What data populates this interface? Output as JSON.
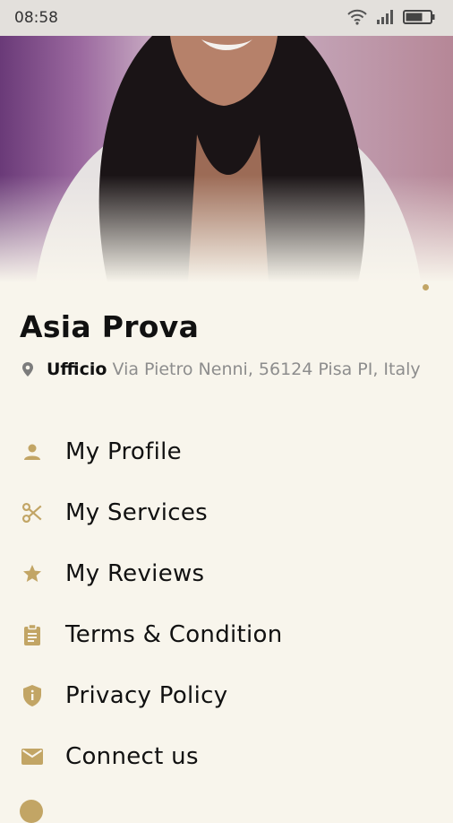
{
  "status_bar": {
    "time": "08:58",
    "icons": [
      "wifi-icon",
      "signal-icon",
      "battery-icon"
    ]
  },
  "profile": {
    "name": "Asia Prova",
    "address_label": "Ufficio",
    "address": "Via Pietro Nenni, 56124 Pisa PI, Italy"
  },
  "menu": {
    "items": [
      {
        "label": "My Profile",
        "icon": "person-icon"
      },
      {
        "label": "My Services",
        "icon": "scissors-icon"
      },
      {
        "label": "My Reviews",
        "icon": "star-icon"
      },
      {
        "label": "Terms & Condition",
        "icon": "clipboard-icon"
      },
      {
        "label": "Privacy Policy",
        "icon": "shield-icon"
      },
      {
        "label": "Connect us",
        "icon": "mail-icon"
      }
    ]
  },
  "colors": {
    "accent": "#c2a565",
    "background": "#f8f5ec"
  }
}
